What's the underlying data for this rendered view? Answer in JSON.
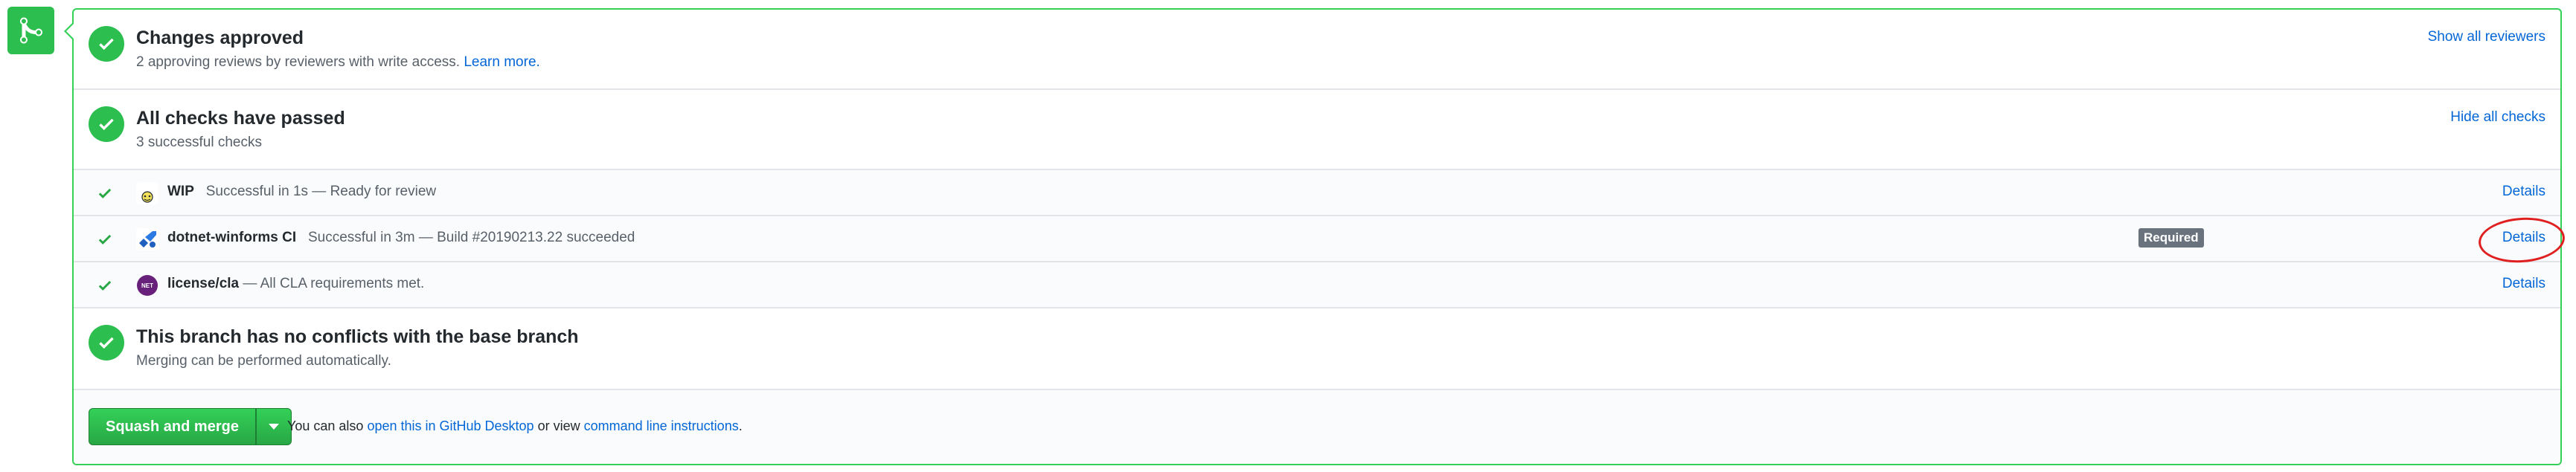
{
  "colors": {
    "success": "#2cbe4e",
    "border_success": "#34d058",
    "link": "#0366d6",
    "annotation": "#e02020"
  },
  "badge_icon": "git-merge-icon",
  "reviews": {
    "title": "Changes approved",
    "subtitle": "2 approving reviews by reviewers with write access.",
    "learn_more": "Learn more.",
    "action": "Show all reviewers"
  },
  "checks": {
    "title": "All checks have passed",
    "subtitle": "3 successful checks",
    "action": "Hide all checks",
    "items": [
      {
        "name": "WIP",
        "description": "Successful in 1s — Ready for review",
        "required": "",
        "details": "Details",
        "avatar": "wip-bot-avatar"
      },
      {
        "name": "dotnet-winforms CI",
        "description": "Successful in 3m — Build #20190213.22 succeeded",
        "required": "Required",
        "details": "Details",
        "avatar": "azure-pipelines-avatar"
      },
      {
        "name": "license/cla",
        "description": "— All CLA requirements met.",
        "required": "",
        "details": "Details",
        "avatar": "dotnet-foundation-avatar",
        "avatar_text": "NET"
      }
    ]
  },
  "conflicts": {
    "title": "This branch has no conflicts with the base branch",
    "subtitle": "Merging can be performed automatically."
  },
  "merge": {
    "button": "Squash and merge",
    "prefix": "You can also",
    "desktop_link": "open this in GitHub Desktop",
    "middle": "or view",
    "cli_link": "command line instructions",
    "suffix": "."
  }
}
